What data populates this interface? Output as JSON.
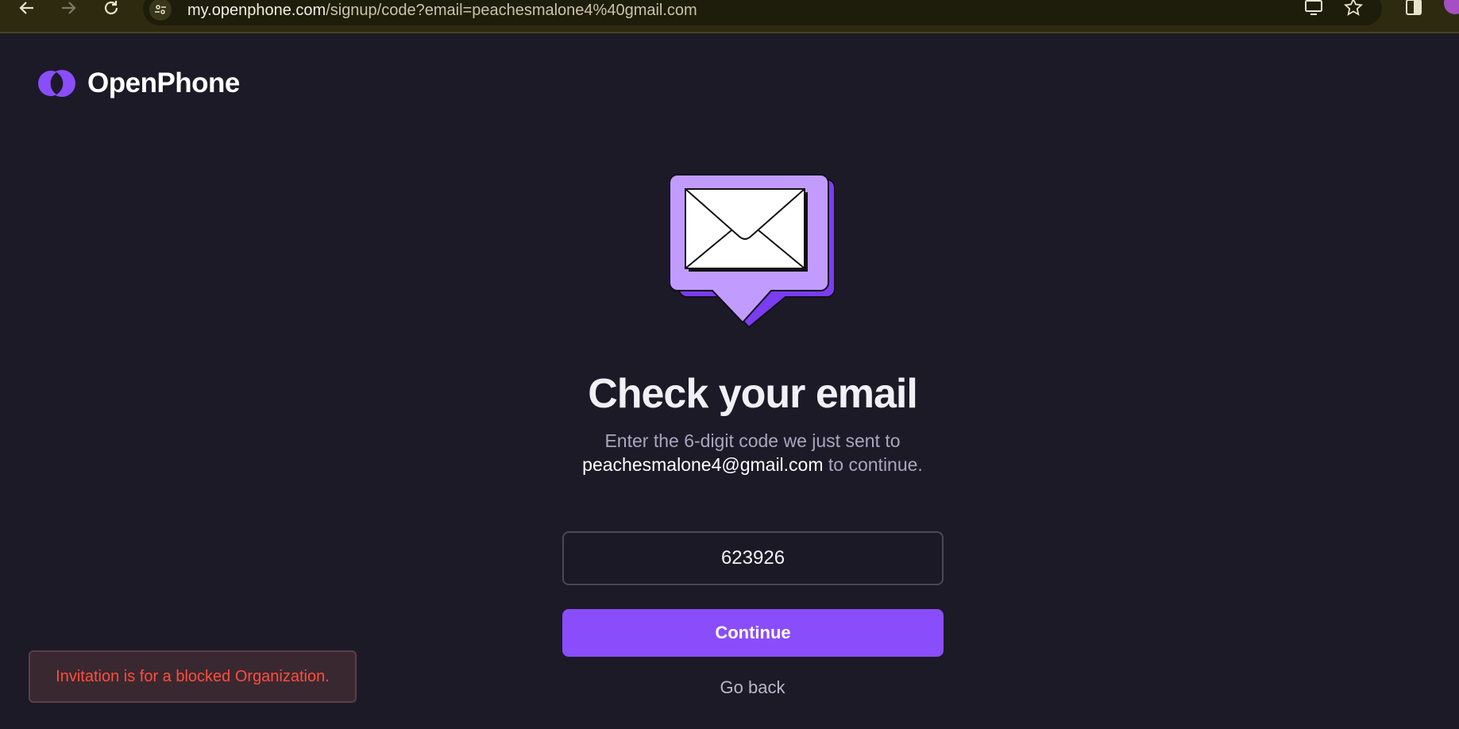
{
  "browser": {
    "url_host": "my.openphone.com",
    "url_path": "/signup/code?email=peachesmalone4%40gmail.com"
  },
  "brand": {
    "name": "OpenPhone",
    "accent": "#8a4dfb"
  },
  "main": {
    "heading": "Check your email",
    "instruction": "Enter the 6-digit code we just sent to",
    "email": "peachesmalone4@gmail.com",
    "instruction_suffix": "to continue.",
    "code_value": "623926",
    "continue_label": "Continue",
    "go_back_label": "Go back"
  },
  "toast": {
    "message": "Invitation is for a blocked Organization.",
    "color": "#ff4d3d"
  }
}
